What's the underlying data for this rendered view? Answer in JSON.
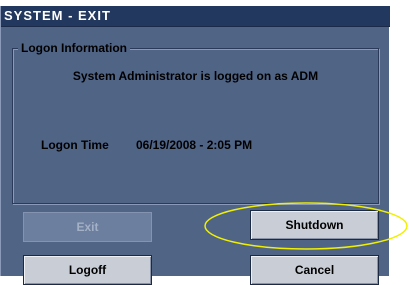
{
  "window": {
    "title": "SYSTEM - EXIT"
  },
  "logon_info": {
    "legend": "Logon Information",
    "message": "System Administrator is logged on as ADM",
    "time_label": "Logon Time",
    "time_value": "06/19/2008 - 2:05 PM"
  },
  "buttons": {
    "exit": "Exit",
    "shutdown": "Shutdown",
    "logoff": "Logoff",
    "cancel": "Cancel"
  },
  "colors": {
    "dialog_bg": "#506486",
    "titlebar_bg": "#22385e",
    "highlight_ellipse": "#f0f000"
  }
}
